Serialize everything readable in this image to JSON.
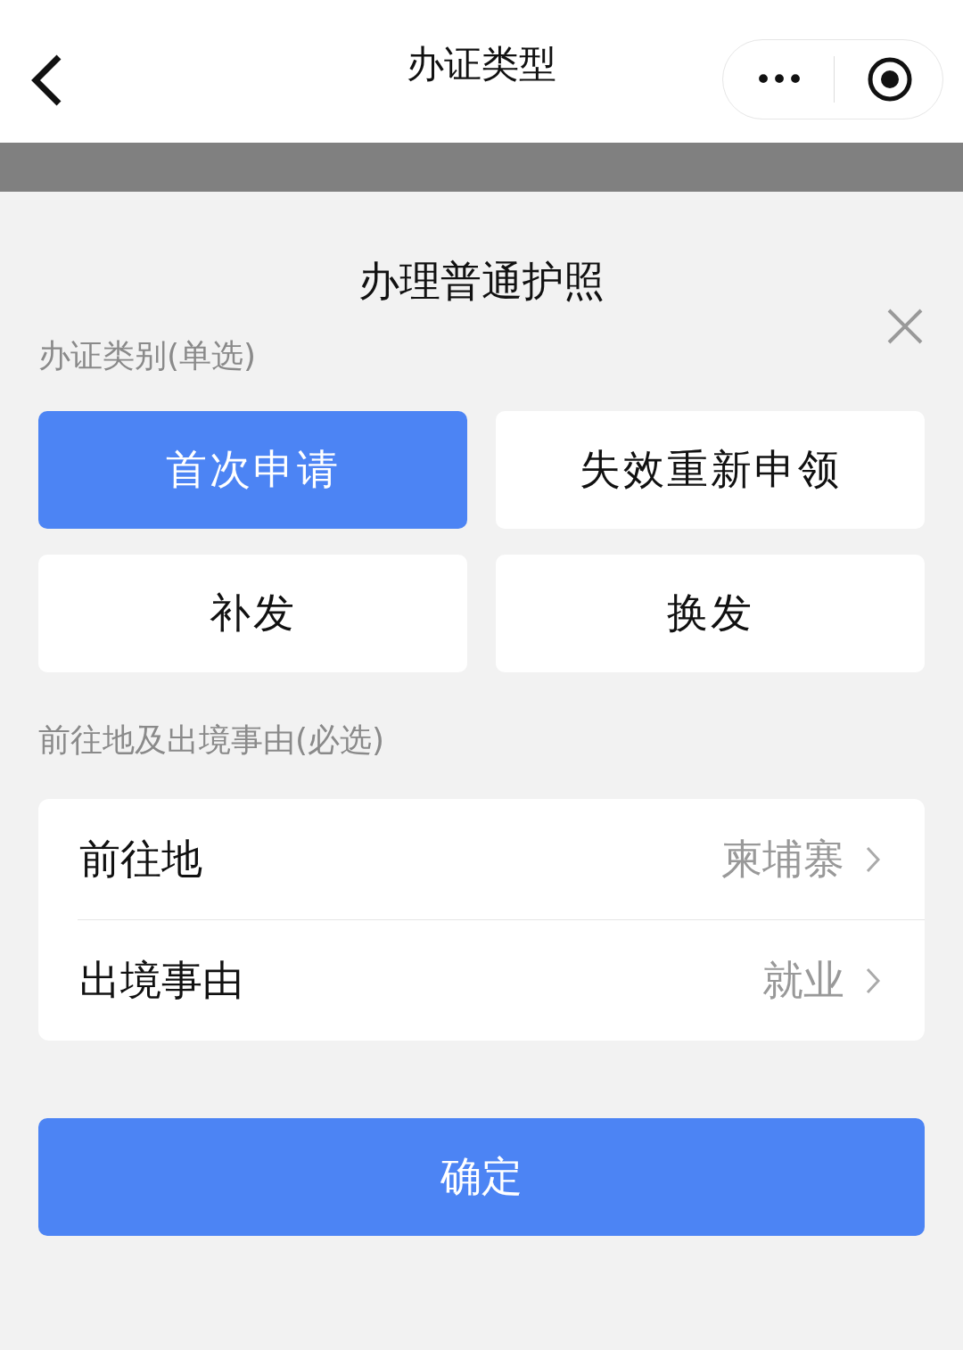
{
  "nav": {
    "title": "办证类型",
    "more": "•••"
  },
  "sheet": {
    "title": "办理普通护照",
    "category_label": "办证类别(单选)",
    "options": [
      {
        "label": "首次申请",
        "selected": true
      },
      {
        "label": "失效重新申领",
        "selected": false
      },
      {
        "label": "补发",
        "selected": false
      },
      {
        "label": "换发",
        "selected": false
      }
    ],
    "destination_label": "前往地及出境事由(必选)",
    "rows": [
      {
        "label": "前往地",
        "value": "柬埔寨"
      },
      {
        "label": "出境事由",
        "value": "就业"
      }
    ],
    "confirm": "确定"
  }
}
